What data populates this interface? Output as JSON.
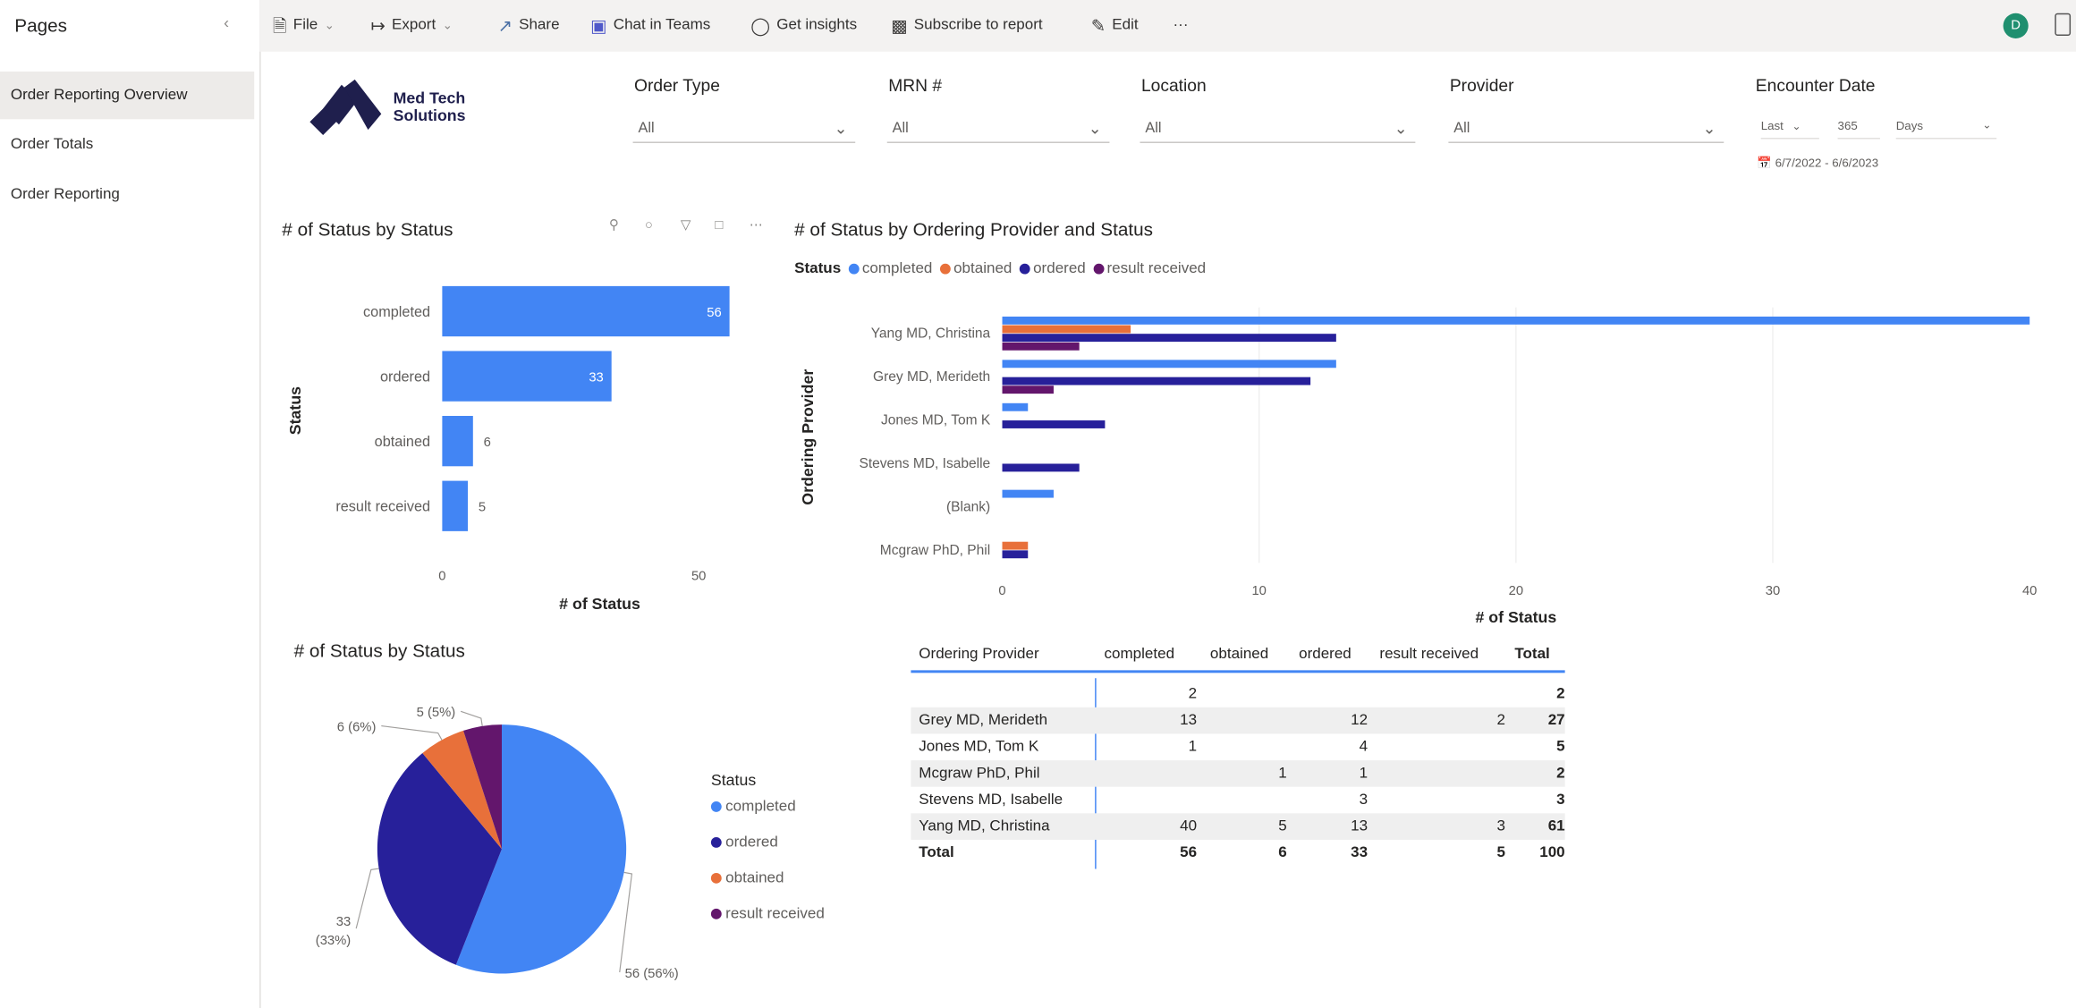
{
  "sidebar": {
    "title": "Pages",
    "collapse_icon": "chevron-left-icon",
    "items": [
      {
        "label": "Order Reporting Overview",
        "active": true
      },
      {
        "label": "Order Totals",
        "active": false
      },
      {
        "label": "Order Reporting",
        "active": false
      }
    ]
  },
  "toolbar": {
    "file": "File",
    "export": "Export",
    "share": "Share",
    "chat": "Chat in Teams",
    "insights": "Get insights",
    "subscribe": "Subscribe to report",
    "edit": "Edit",
    "more": "···",
    "avatar": "D"
  },
  "logo": {
    "line1": "Med Tech",
    "line2": "Solutions"
  },
  "filters": {
    "order_type": {
      "label": "Order Type",
      "value": "All"
    },
    "mrn": {
      "label": "MRN #",
      "value": "All"
    },
    "location": {
      "label": "Location",
      "value": "All"
    },
    "provider": {
      "label": "Provider",
      "value": "All"
    },
    "encounter_date": {
      "label": "Encounter Date",
      "relative": "Last",
      "count": "365",
      "unit": "Days",
      "range": "6/7/2022 - 6/6/2023"
    }
  },
  "colors": {
    "completed": "#4285f4",
    "obtained": "#e8703a",
    "ordered": "#27209a",
    "result_received": "#63166c"
  },
  "chart_data": [
    {
      "type": "bar",
      "orientation": "horizontal",
      "title": "# of Status by Status",
      "categories": [
        "completed",
        "ordered",
        "obtained",
        "result received"
      ],
      "values": [
        56,
        33,
        6,
        5
      ],
      "xlabel": "# of Status",
      "ylabel": "Status",
      "xticks": [
        "0",
        "50"
      ],
      "xlim": [
        0,
        56
      ]
    },
    {
      "type": "bar",
      "orientation": "horizontal",
      "title": "# of Status by Ordering Provider and Status",
      "legend_title": "Status",
      "categories": [
        "Yang MD, Christina",
        "Grey MD, Merideth",
        "Jones MD, Tom K",
        "Stevens MD, Isabelle",
        "(Blank)",
        "Mcgraw PhD, Phil"
      ],
      "series": [
        {
          "name": "completed",
          "values": [
            40,
            13,
            1,
            0,
            2,
            0
          ]
        },
        {
          "name": "obtained",
          "values": [
            5,
            0,
            0,
            0,
            0,
            1
          ]
        },
        {
          "name": "ordered",
          "values": [
            13,
            12,
            4,
            3,
            0,
            1
          ]
        },
        {
          "name": "result received",
          "values": [
            3,
            2,
            0,
            0,
            0,
            0
          ]
        }
      ],
      "xlabel": "# of Status",
      "ylabel": "Ordering Provider",
      "xticks": [
        "0",
        "10",
        "20",
        "30",
        "40"
      ],
      "xlim": [
        0,
        40
      ]
    },
    {
      "type": "pie",
      "title": "# of Status by Status",
      "legend_title": "Status",
      "slices": [
        {
          "name": "completed",
          "value": 56,
          "label": "56 (56%)"
        },
        {
          "name": "ordered",
          "value": 33,
          "label": "33 (33%)"
        },
        {
          "name": "obtained",
          "value": 6,
          "label": "6 (6%)"
        },
        {
          "name": "result received",
          "value": 5,
          "label": "5 (5%)"
        }
      ]
    },
    {
      "type": "table",
      "columns": [
        "Ordering Provider",
        "completed",
        "obtained",
        "ordered",
        "result received",
        "Total"
      ],
      "rows": [
        [
          "",
          "2",
          "",
          "",
          "",
          "2"
        ],
        [
          "Grey MD, Merideth",
          "13",
          "",
          "12",
          "2",
          "27"
        ],
        [
          "Jones MD, Tom K",
          "1",
          "",
          "4",
          "",
          "5"
        ],
        [
          "Mcgraw PhD, Phil",
          "",
          "1",
          "1",
          "",
          "2"
        ],
        [
          "Stevens MD, Isabelle",
          "",
          "",
          "3",
          "",
          "3"
        ],
        [
          "Yang MD, Christina",
          "40",
          "5",
          "13",
          "3",
          "61"
        ]
      ],
      "total_row": [
        "Total",
        "56",
        "6",
        "33",
        "5",
        "100"
      ]
    }
  ]
}
